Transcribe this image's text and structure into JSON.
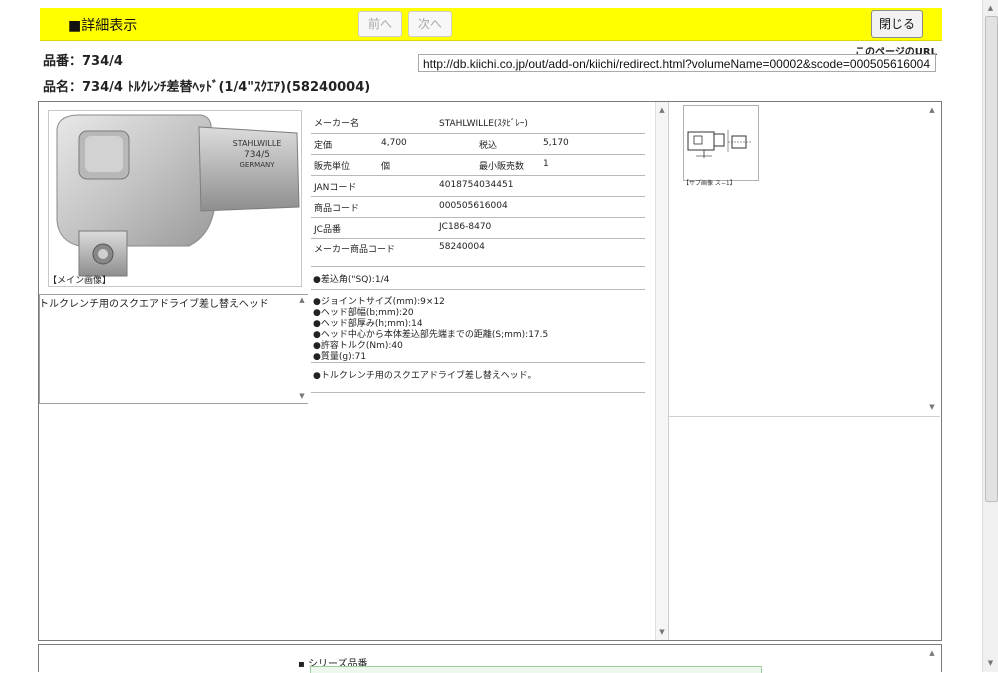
{
  "topbar": {
    "title": "■詳細表示",
    "prev_label": "前へ",
    "next_label": "次へ",
    "close_label": "閉じる"
  },
  "header": {
    "product_code": "品番：734/4",
    "product_name": "品名：734/4 ﾄﾙｸﾚﾝﾁ差替ﾍｯﾄﾞ(1/4\"ｽｸｴｱ)(58240004)",
    "url_label": "このページのURL",
    "url_value": "http://db.kiichi.co.jp/out/add-on/kiichi/redirect.html?volumeName=00002&scode=000505616004"
  },
  "left": {
    "image_caption": "【メイン画像】",
    "image_engraving": [
      "STAHLWILLE",
      "734/5",
      "GERMANY"
    ],
    "description": "トルクレンチ用のスクエアドライブ差し替えヘッド"
  },
  "details": {
    "maker_label": "メーカー名",
    "maker_value": "STAHLWILLE(ｽﾀﾋﾞﾚｰ)",
    "price_label": "定価",
    "price_value": "4,700",
    "taxin_label": "税込",
    "taxin_value": "5,170",
    "unit_label": "販売単位",
    "unit_value": "個",
    "minqty_label": "最小販売数",
    "minqty_value": "1",
    "jan_label": "JANコード",
    "jan_value": "4018754034451",
    "code_label": "商品コード",
    "code_value": "000505616004",
    "jc_label": "JC品番",
    "jc_value": "JC186-8470",
    "makercode_label": "メーカー商品コード",
    "makercode_value": "58240004",
    "spec_header": "●差込角(\"SQ):1/4",
    "specs": [
      "●ジョイントサイズ(mm):9×12",
      "●ヘッド部幅(b;mm):20",
      "●ヘッド部厚み(h;mm):14",
      "●ヘッド中心から本体差込部先端までの距離(S;mm):17.5",
      "●許容トルク(Nm):40",
      "●質量(g):71"
    ],
    "note": "●トルクレンチ用のスクエアドライブ差し替えヘッド。"
  },
  "right": {
    "thumb_caption": "【サブ画像 ス−1】"
  },
  "footer": {
    "series_label": "シリーズ品番"
  }
}
